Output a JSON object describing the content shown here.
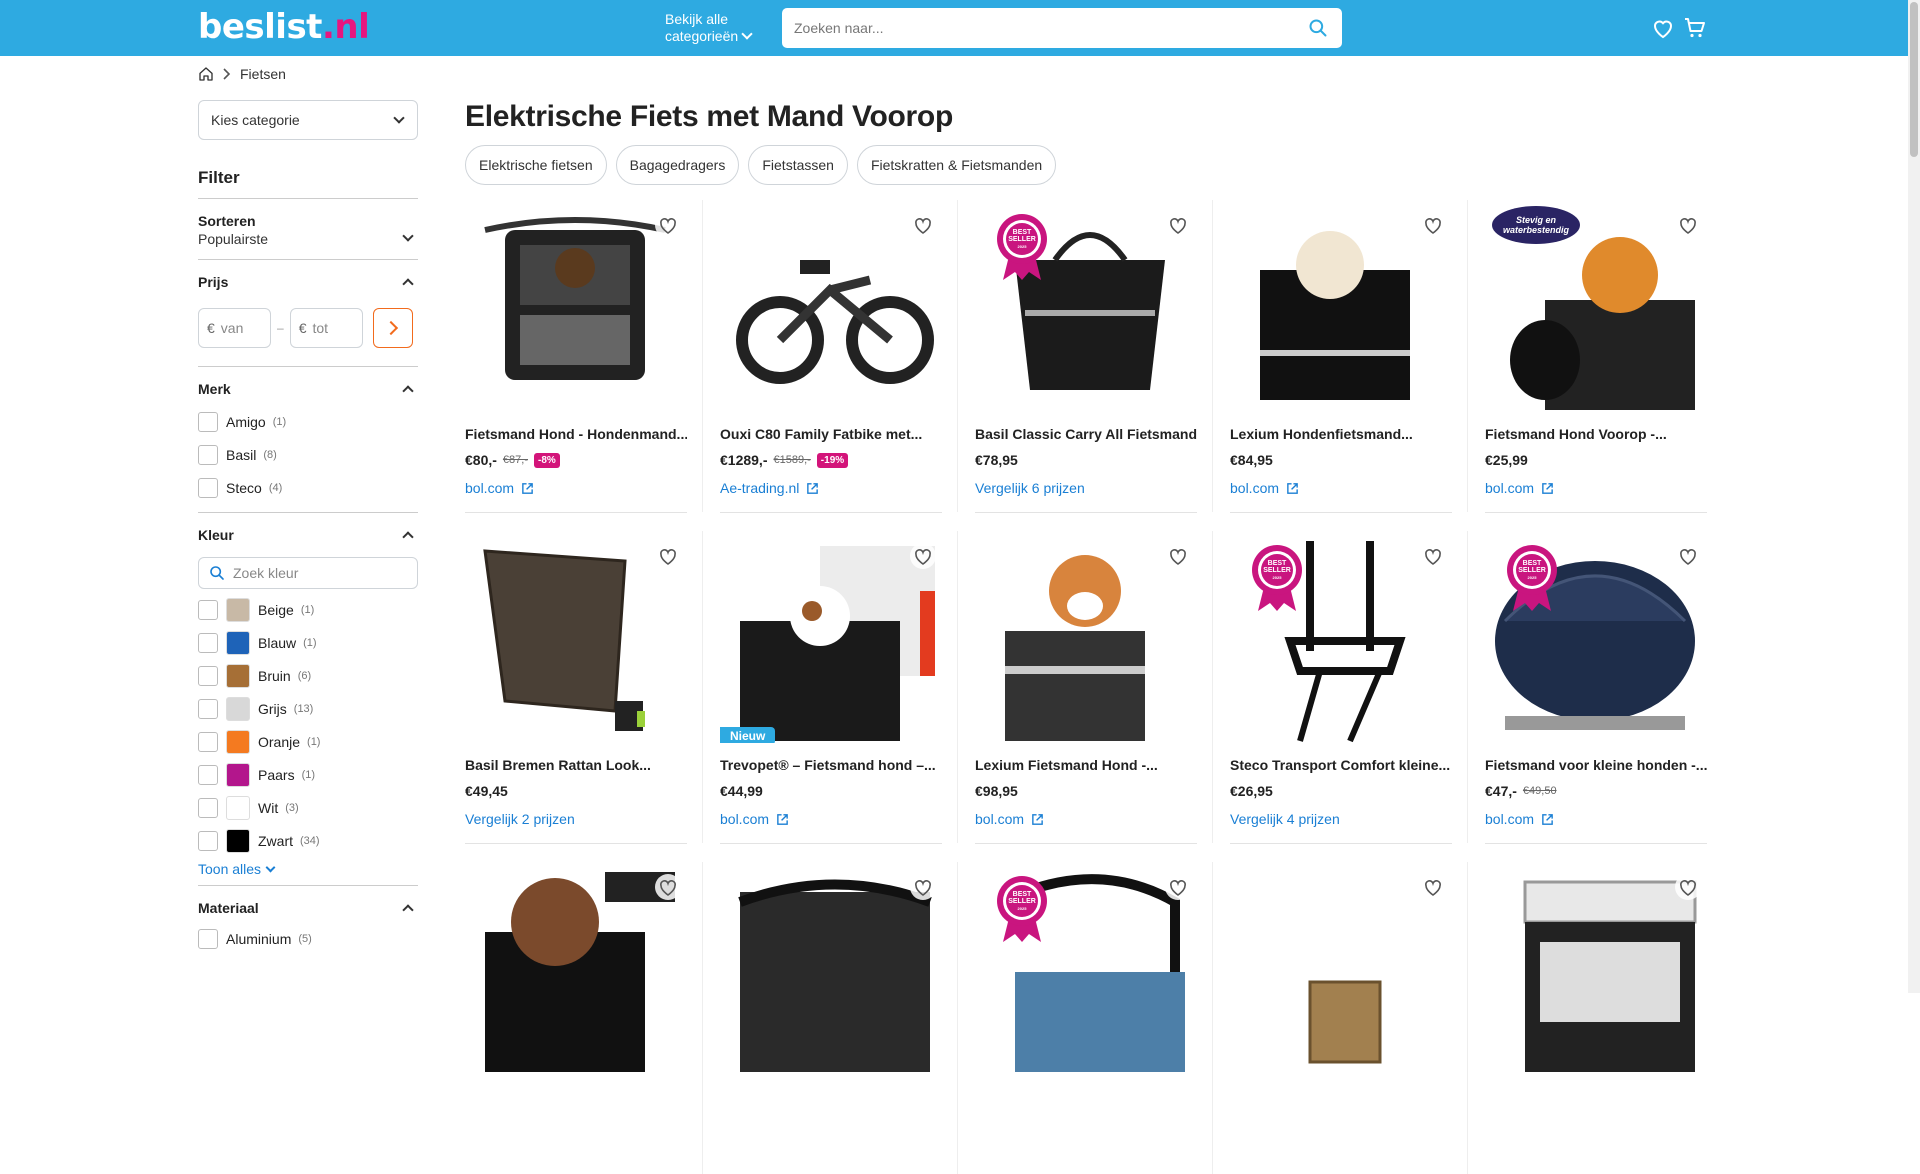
{
  "header": {
    "logo": {
      "main": "beslist",
      "dot": ".",
      "tld": "nl"
    },
    "categories_line1": "Bekijk alle",
    "categories_line2": "categorieën",
    "search_placeholder": "Zoeken naar...",
    "icons": [
      "heart-icon",
      "cart-icon"
    ]
  },
  "breadcrumb": {
    "current": "Fietsen"
  },
  "sidebar": {
    "category_select": "Kies categorie",
    "filter_title": "Filter",
    "sort": {
      "label": "Sorteren",
      "value": "Populairste"
    },
    "price": {
      "label": "Prijs",
      "currency": "€",
      "from_placeholder": "van",
      "to_placeholder": "tot",
      "dash": "–"
    },
    "brand": {
      "label": "Merk",
      "items": [
        {
          "name": "Amigo",
          "count": "(1)"
        },
        {
          "name": "Basil",
          "count": "(8)"
        },
        {
          "name": "Steco",
          "count": "(4)"
        }
      ]
    },
    "color": {
      "label": "Kleur",
      "search_placeholder": "Zoek kleur",
      "items": [
        {
          "name": "Beige",
          "count": "(1)",
          "hex": "#c8b9a6"
        },
        {
          "name": "Blauw",
          "count": "(1)",
          "hex": "#1e63b8"
        },
        {
          "name": "Bruin",
          "count": "(6)",
          "hex": "#a66f36"
        },
        {
          "name": "Grijs",
          "count": "(13)",
          "hex": "#d8d8d8"
        },
        {
          "name": "Oranje",
          "count": "(1)",
          "hex": "#f47a20"
        },
        {
          "name": "Paars",
          "count": "(1)",
          "hex": "#b3168c"
        },
        {
          "name": "Wit",
          "count": "(3)",
          "hex": "#ffffff"
        },
        {
          "name": "Zwart",
          "count": "(34)",
          "hex": "#000000"
        }
      ],
      "show_all": "Toon alles"
    },
    "material": {
      "label": "Materiaal",
      "items": [
        {
          "name": "Aluminium",
          "count": "(5)"
        }
      ]
    }
  },
  "main": {
    "title": "Elektrische Fiets met Mand Voorop",
    "chips": [
      "Elektrische fietsen",
      "Bagagedragers",
      "Fietstassen",
      "Fietskratten & Fietsmanden"
    ],
    "products": [
      {
        "name": "Fietsmand Hond - Hondenmand...",
        "price": "€80,-",
        "old": "€87,-",
        "discount": "-8%",
        "shop": "bol.com",
        "image": "black-dog-carrier",
        "best": false,
        "new": false
      },
      {
        "name": "Ouxi C80 Family Fatbike met...",
        "price": "€1289,-",
        "old": "€1589,-",
        "discount": "-19%",
        "shop": "Ae-trading.nl",
        "image": "fatbike",
        "best": false,
        "new": false
      },
      {
        "name": "Basil Classic Carry All Fietsmand...",
        "price": "€78,95",
        "old": "",
        "discount": "",
        "shop": "Vergelijk 6 prijzen",
        "image": "black-bag",
        "best": true,
        "new": false
      },
      {
        "name": "Lexium Hondenfietsmand...",
        "price": "€84,95",
        "old": "",
        "discount": "",
        "shop": "bol.com",
        "image": "dog-basket",
        "best": false,
        "new": false
      },
      {
        "name": "Fietsmand Hond Voorop -...",
        "price": "€25,99",
        "old": "",
        "discount": "",
        "shop": "bol.com",
        "image": "pom-basket",
        "best": false,
        "new": false,
        "sticker": "Stevig en waterbestendig"
      },
      {
        "name": "Basil Bremen Rattan Look...",
        "price": "€49,45",
        "old": "",
        "discount": "",
        "shop": "Vergelijk 2 prijzen",
        "image": "rattan",
        "best": false,
        "new": false
      },
      {
        "name": "Trevopet® – Fietsmand hond –...",
        "price": "€44,99",
        "old": "",
        "discount": "",
        "shop": "bol.com",
        "image": "trevopet",
        "best": false,
        "new": true,
        "new_label": "Nieuw"
      },
      {
        "name": "Lexium Fietsmand Hond -...",
        "price": "€98,95",
        "old": "",
        "discount": "",
        "shop": "bol.com",
        "image": "corgi",
        "best": false,
        "new": false
      },
      {
        "name": "Steco Transport Comfort kleine...",
        "price": "€26,95",
        "old": "",
        "discount": "",
        "shop": "Vergelijk 4 prijzen",
        "image": "rack",
        "best": true,
        "new": false
      },
      {
        "name": "Fietsmand voor kleine honden -...",
        "price": "€47,-",
        "old": "€49,50",
        "discount": "",
        "shop": "bol.com",
        "image": "navy-carrier",
        "best": true,
        "new": false
      },
      {
        "name": "",
        "price": "",
        "old": "",
        "discount": "",
        "shop": "",
        "image": "poodle",
        "best": false,
        "new": false
      },
      {
        "name": "",
        "price": "",
        "old": "",
        "discount": "",
        "shop": "",
        "image": "mesh",
        "best": false,
        "new": false
      },
      {
        "name": "",
        "price": "",
        "old": "",
        "discount": "",
        "shop": "",
        "image": "blue-crate",
        "best": true,
        "new": false
      },
      {
        "name": "",
        "price": "",
        "old": "",
        "discount": "",
        "shop": "",
        "image": "small-basket",
        "best": false,
        "new": false
      },
      {
        "name": "",
        "price": "",
        "old": "",
        "discount": "",
        "shop": "",
        "image": "canopy",
        "best": false,
        "new": false
      }
    ],
    "best_seller": {
      "line1": "BEST",
      "line2": "SELLER",
      "line3": "2025"
    }
  },
  "colors": {
    "header": "#2eaae1",
    "accent": "#e7157f",
    "link": "#1a7fd4",
    "price_go": "#f26b1d"
  }
}
